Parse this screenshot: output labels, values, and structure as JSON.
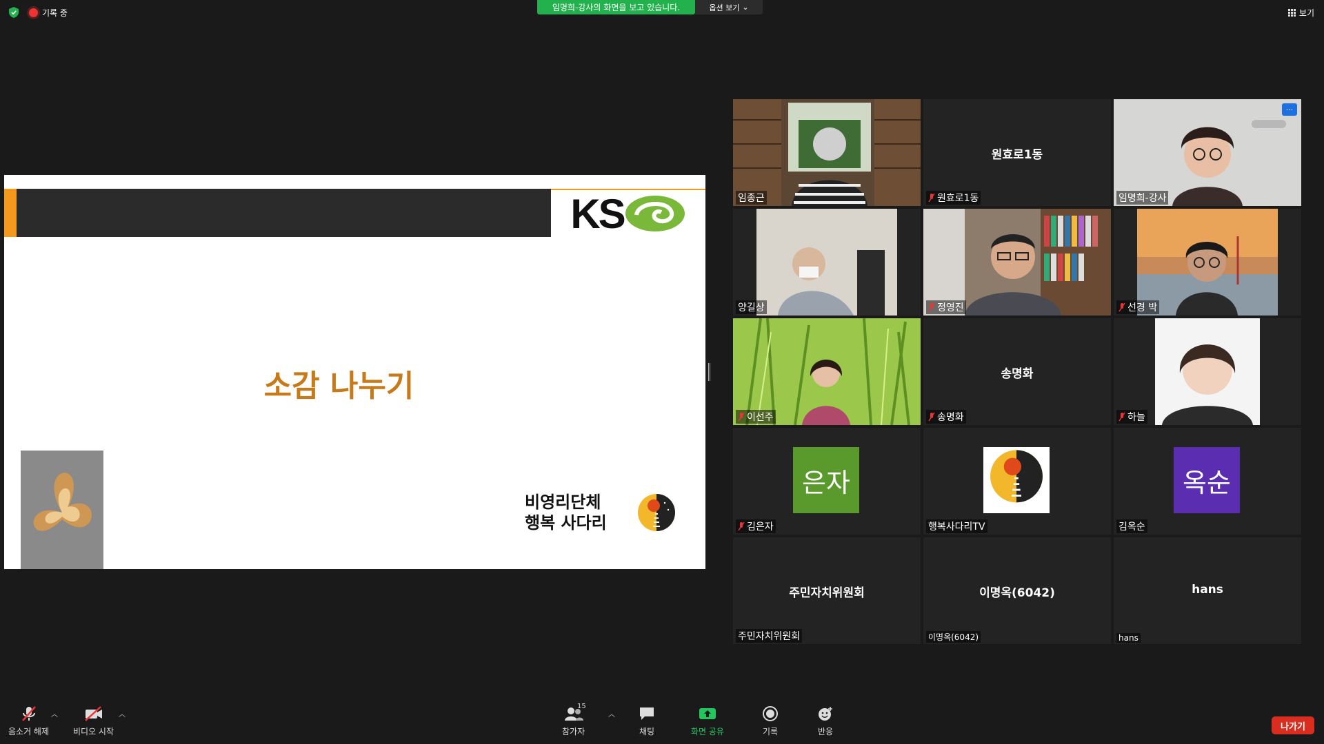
{
  "topbar": {
    "recording_label": "기록 중",
    "viewing_banner": "임명희-강사의 화면을 보고 있습니다.",
    "view_options_label": "옵션 보기",
    "view_label": "보기"
  },
  "slide": {
    "logo_text": "KS",
    "title": "소감 나누기",
    "org_line1": "비영리단체",
    "org_line2": "행복 사다리"
  },
  "participants": [
    {
      "name": "임종근",
      "muted": false,
      "big": "",
      "kind": "video"
    },
    {
      "name": "원효로1동",
      "muted": true,
      "big": "원효로1동",
      "kind": "name"
    },
    {
      "name": "임명희-강사",
      "muted": false,
      "big": "",
      "kind": "video",
      "active": true
    },
    {
      "name": "양길상",
      "muted": false,
      "big": "",
      "kind": "video"
    },
    {
      "name": "정영진",
      "muted": true,
      "big": "",
      "kind": "video"
    },
    {
      "name": "선경 박",
      "muted": true,
      "big": "",
      "kind": "video"
    },
    {
      "name": "이선주",
      "muted": true,
      "big": "",
      "kind": "video"
    },
    {
      "name": "송명화",
      "muted": true,
      "big": "송명화",
      "kind": "name"
    },
    {
      "name": "하늘",
      "muted": true,
      "big": "",
      "kind": "video"
    },
    {
      "name": "김은자",
      "muted": true,
      "big": "은자",
      "kind": "avatar",
      "color": "#5a9a2c"
    },
    {
      "name": "행복사다리TV",
      "muted": false,
      "big": "",
      "kind": "logo"
    },
    {
      "name": "김옥순",
      "muted": false,
      "big": "옥순",
      "kind": "avatar",
      "color": "#5b2db0"
    },
    {
      "name": "주민자치위원회",
      "muted": false,
      "big": "주민자치위원회",
      "kind": "name"
    },
    {
      "name": "이명옥(6042)",
      "muted": false,
      "big": "이명옥(6042)",
      "kind": "name"
    },
    {
      "name": "hans",
      "muted": false,
      "big": "hans",
      "kind": "name"
    }
  ],
  "toolbar": {
    "unmute_label": "음소거 해제",
    "start_video_label": "비디오 시작",
    "participants_label": "참가자",
    "participants_count": "15",
    "chat_label": "채팅",
    "share_label": "화면 공유",
    "record_label": "기록",
    "reactions_label": "반응",
    "leave_label": "나가기"
  },
  "colors": {
    "banner_green": "#22b14c",
    "leave_red": "#d92d20",
    "slide_title": "#c77a1a",
    "active_outline": "#c8e05a"
  }
}
